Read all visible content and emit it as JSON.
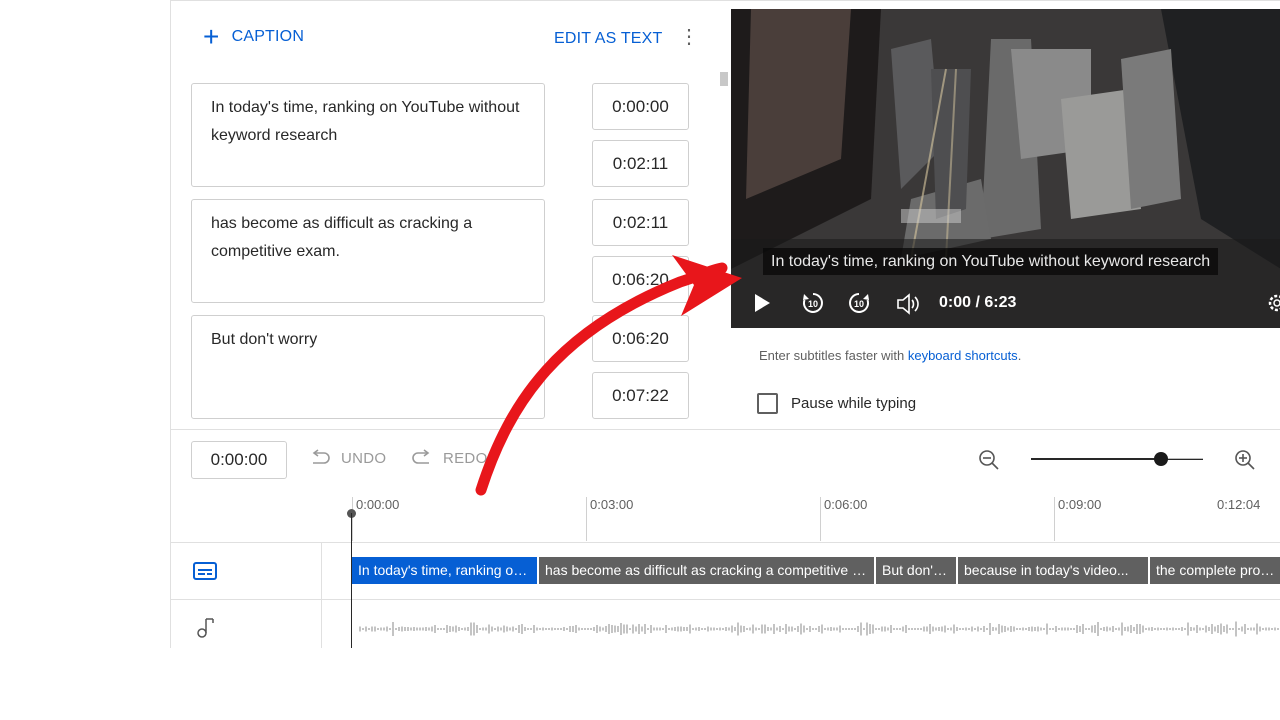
{
  "toolbar": {
    "add_caption_label": "CAPTION",
    "edit_as_text_label": "EDIT AS TEXT",
    "more_icon": "more-vert-icon"
  },
  "captions": [
    {
      "text": "In today's time, ranking on YouTube without keyword research",
      "start": "0:00:00",
      "end": "0:02:11"
    },
    {
      "text": "has become as difficult as cracking a competitive exam.",
      "start": "0:02:11",
      "end": "0:06:20"
    },
    {
      "text": "But don't worry",
      "start": "0:06:20",
      "end": "0:07:22"
    }
  ],
  "player": {
    "subtitle": "In today's time, ranking on YouTube without keyword research",
    "time": "0:00 / 6:23",
    "icons": [
      "play-icon",
      "rewind-10-icon",
      "forward-10-icon",
      "volume-icon",
      "settings-icon"
    ]
  },
  "hint": {
    "text": "Enter subtitles faster with ",
    "link": "keyboard shortcuts",
    "suffix": "."
  },
  "pause_while_typing": {
    "label": "Pause while typing",
    "checked": false
  },
  "timeline": {
    "current_time": "0:00:00",
    "undo_label": "UNDO",
    "redo_label": "REDO",
    "ruler": [
      "0:00:00",
      "0:03:00",
      "0:06:00",
      "0:09:00",
      "0:12:04"
    ],
    "zoom_level": 0.76,
    "segments": [
      "In today's time, ranking on YouTube without keyword research",
      "has become as difficult as cracking a competitive exam.",
      "But don't worry",
      "because in today's video...",
      "the complete process"
    ]
  },
  "colors": {
    "accent": "#065fd4",
    "segment": "#606060",
    "annotation_arrow": "#e8161b"
  }
}
